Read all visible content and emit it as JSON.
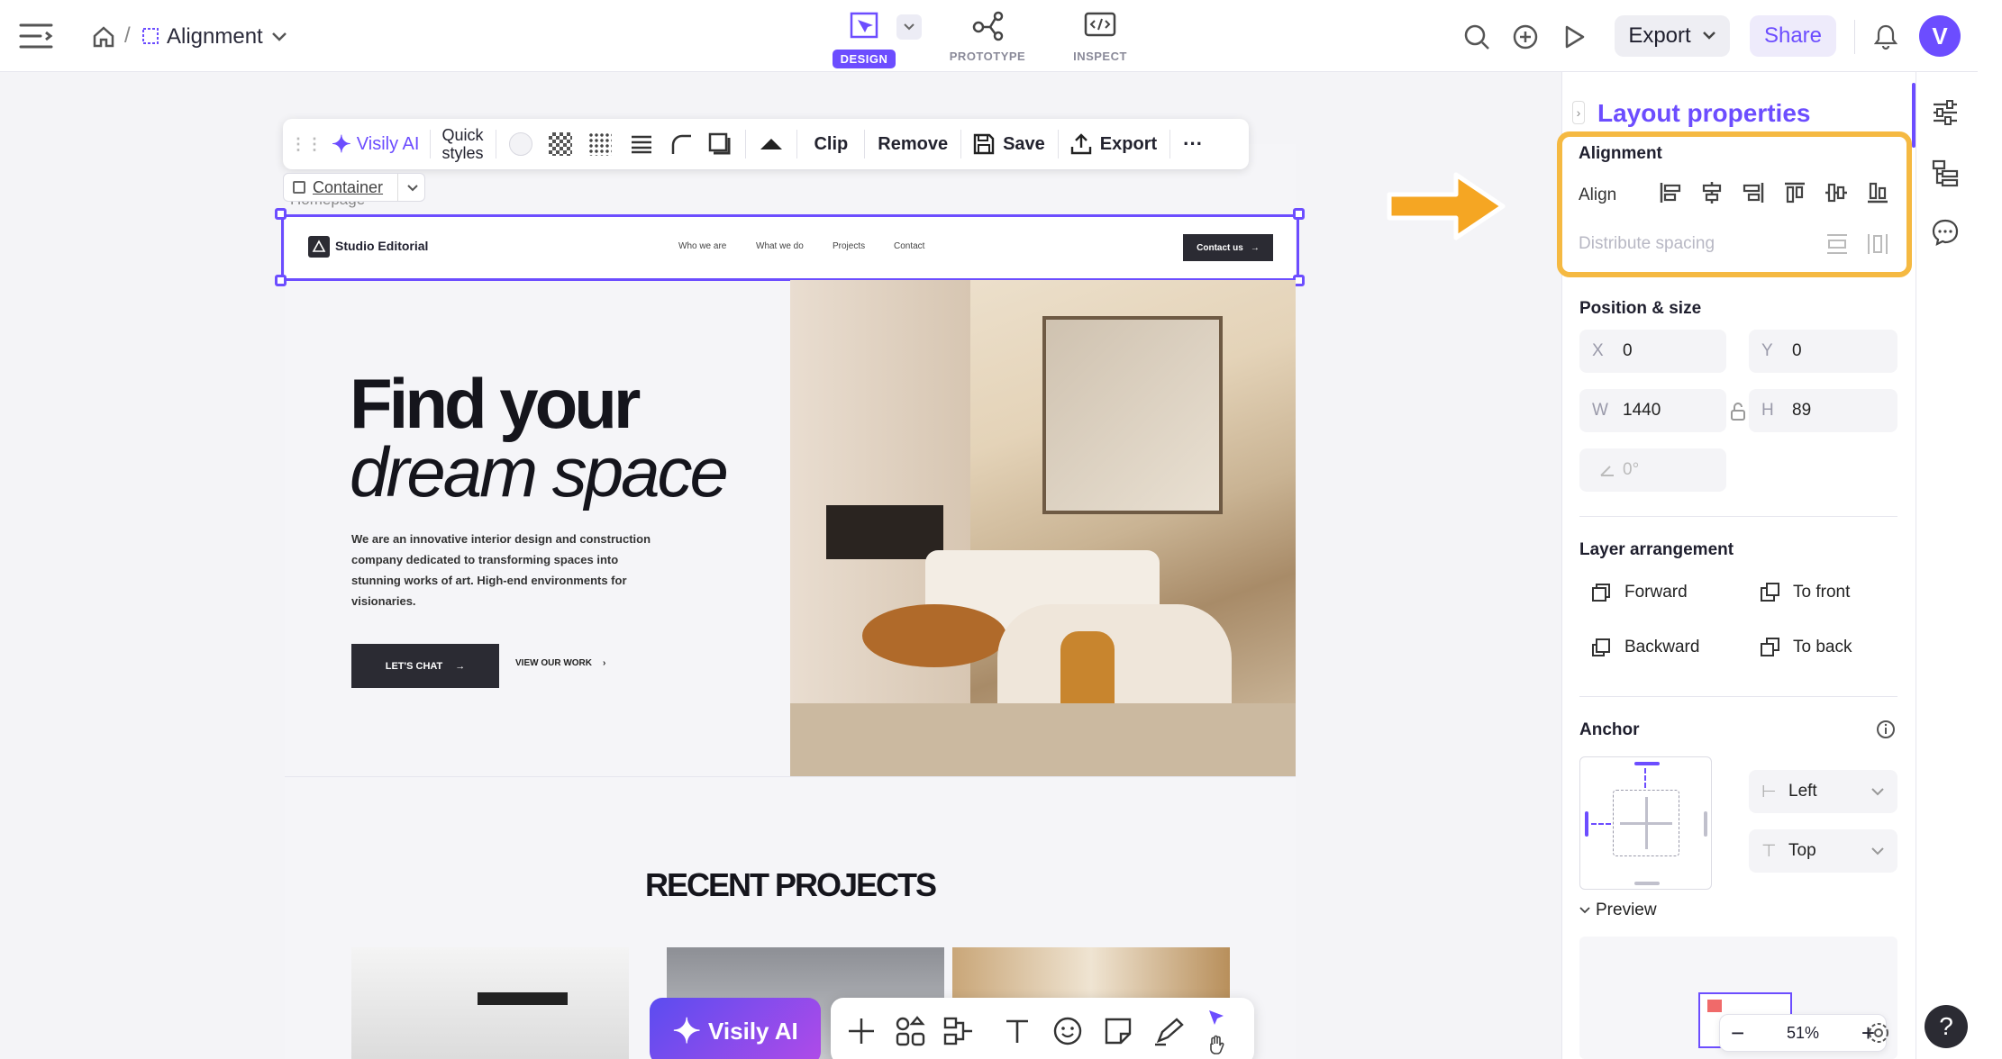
{
  "topbar": {
    "file_name": "Alignment",
    "modes": [
      {
        "label": "DESIGN",
        "active": true
      },
      {
        "label": "PROTOTYPE",
        "active": false
      },
      {
        "label": "INSPECT",
        "active": false
      }
    ],
    "export_label": "Export",
    "share_label": "Share",
    "avatar_initial": "V"
  },
  "context_toolbar": {
    "ai_label": "Visily AI",
    "quick_styles_line1": "Quick",
    "quick_styles_line2": "styles",
    "clip_label": "Clip",
    "remove_label": "Remove",
    "save_label": "Save",
    "export_label": "Export",
    "more_label": "···"
  },
  "selection_chip": {
    "label": "Container",
    "under_label": "Homepage"
  },
  "mockup": {
    "brand": "Studio Editorial",
    "nav_links": [
      "Who we are",
      "What we do",
      "Projects",
      "Contact"
    ],
    "cta": "Contact us",
    "hero_line1": "Find your",
    "hero_line2": "dream space",
    "hero_body": "We are an innovative interior design and construction company dedicated to transforming spaces into stunning works of art. High-end environments for visionaries.",
    "primary_btn": "LET'S CHAT",
    "secondary_btn": "VIEW OUR WORK",
    "section_title": "RECENT PROJECTS"
  },
  "dock": {
    "ai_label": "Visily AI"
  },
  "panel": {
    "title": "Layout properties",
    "alignment": {
      "title": "Alignment",
      "align_label": "Align",
      "distribute_label": "Distribute spacing"
    },
    "position": {
      "title": "Position & size",
      "x_label": "X",
      "x": "0",
      "y_label": "Y",
      "y": "0",
      "w_label": "W",
      "w": "1440",
      "h_label": "H",
      "h": "89",
      "rotation": "0°"
    },
    "layer": {
      "title": "Layer arrangement",
      "forward": "Forward",
      "to_front": "To front",
      "backward": "Backward",
      "to_back": "To back"
    },
    "anchor": {
      "title": "Anchor",
      "horizontal": "Left",
      "vertical": "Top"
    },
    "preview_label": "Preview",
    "zoom": "51%"
  },
  "colors": {
    "accent": "#6c4dff",
    "highlight": "#f5b942",
    "arrow": "#f5a623"
  }
}
